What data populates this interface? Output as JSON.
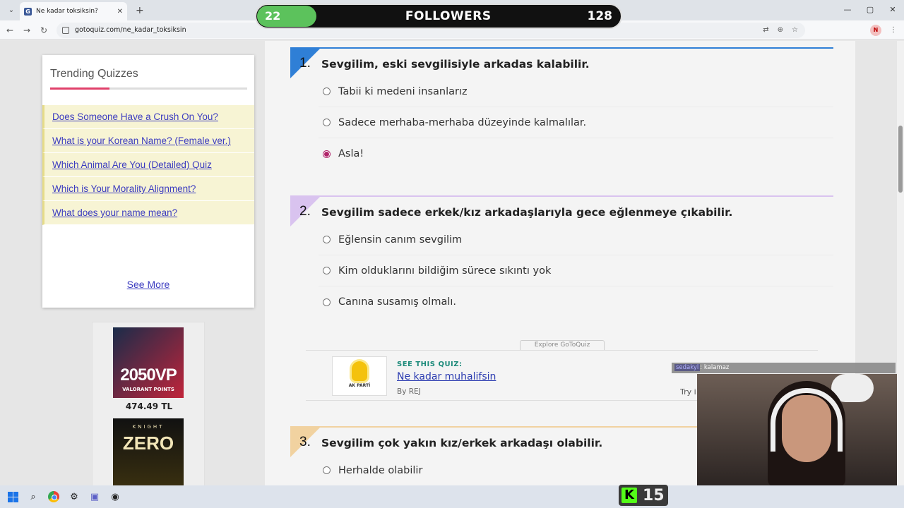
{
  "browser": {
    "tab_title": "Ne kadar toksiksin?",
    "url": "gotoquiz.com/ne_kadar_toksiksin",
    "profile_initial": "N"
  },
  "overlay": {
    "followers_current": "22",
    "followers_label": "FOLLOWERS",
    "followers_goal": "128"
  },
  "sidebar": {
    "title": "Trending Quizzes",
    "items": [
      {
        "label": "Does Someone Have a Crush On You?"
      },
      {
        "label": "What is your Korean Name? (Female ver.)"
      },
      {
        "label": "Which Animal Are You (Detailed) Quiz"
      },
      {
        "label": "Which is Your Morality Alignment?"
      },
      {
        "label": "What does your name mean?"
      }
    ],
    "see_more": "See More"
  },
  "products": [
    {
      "title": "2050VP",
      "subtitle": "VALORANT POINTS",
      "price": "474.49 TL"
    },
    {
      "title": "ZERO",
      "subtitle": "KNIGHT"
    }
  ],
  "questions": [
    {
      "number": "1.",
      "text": "Sevgilim, eski sevgilisiyle arkadas kalabilir.",
      "color": "#2f7fd6",
      "options": [
        {
          "label": "Tabii ki medeni insanlarız",
          "selected": false
        },
        {
          "label": "Sadece merhaba-merhaba düzeyinde kalmalılar.",
          "selected": false
        },
        {
          "label": "Asla!",
          "selected": true
        }
      ]
    },
    {
      "number": "2.",
      "text": "Sevgilim sadece erkek/kız arkadaşlarıyla gece eğlenmeye çıkabilir.",
      "color": "#b07ad6",
      "options": [
        {
          "label": "Eğlensin canım sevgilim",
          "selected": false
        },
        {
          "label": "Kim olduklarını bildiğim sürece sıkıntı yok",
          "selected": false
        },
        {
          "label": "Canına susamış olmalı.",
          "selected": false
        }
      ]
    },
    {
      "number": "3.",
      "text": "Sevgilim çok yakın kız/erkek arkadaşı olabilir.",
      "color": "#e8a13a",
      "options": [
        {
          "label": "Herhalde olabilir",
          "selected": false
        }
      ]
    }
  ],
  "promo": {
    "explore": "Explore GoToQuiz",
    "kicker": "SEE THIS QUIZ:",
    "title": "Ne kadar muhalifsin",
    "by": "By REJ",
    "try": "Try i",
    "image_label": "AK PARTİ"
  },
  "stream": {
    "chat_user": "sedakyl",
    "chat_text": "kalamaz",
    "kick_count": "15"
  }
}
